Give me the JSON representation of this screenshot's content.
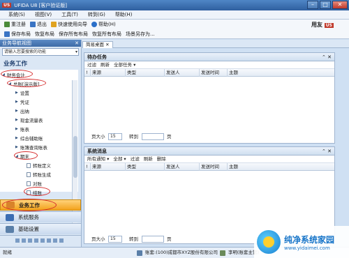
{
  "window": {
    "logo": "US",
    "title": "UFIDA U8 [客户验证版]"
  },
  "menu": [
    "系统(S)",
    "视图(V)",
    "工具(T)",
    "转到(G)",
    "帮助(H)"
  ],
  "toolbar1": [
    {
      "label": "重注册",
      "icon": "refresh-icon"
    },
    {
      "label": "退出",
      "icon": "exit-icon"
    },
    {
      "label": "快速使用向导",
      "icon": "wizard-icon"
    },
    {
      "label": "帮助(H)",
      "icon": "help-icon"
    }
  ],
  "brand": {
    "badge": "US",
    "text": "用友"
  },
  "toolbar2": [
    "保存布局",
    "恢复布局",
    "保存所有布局",
    "恢复所有布局",
    "场景另存为..."
  ],
  "left": {
    "header": "业务导航视图",
    "search_placeholder": "请输入您要搜索的功能",
    "title": "业务工作",
    "tree": [
      {
        "label": "财务会计",
        "level": 0
      },
      {
        "label": "总账[演示版]",
        "level": 1
      },
      {
        "label": "设置",
        "level": 2
      },
      {
        "label": "凭证",
        "level": 2
      },
      {
        "label": "出纳",
        "level": 2
      },
      {
        "label": "现金流量表",
        "level": 2
      },
      {
        "label": "账表",
        "level": 2
      },
      {
        "label": "综合辅助账",
        "level": 2
      },
      {
        "label": "账簿查询账表",
        "level": 2
      },
      {
        "label": "期末",
        "level": 2
      },
      {
        "label": "转账定义",
        "level": 3
      },
      {
        "label": "转账生成",
        "level": 3
      },
      {
        "label": "对账",
        "level": 3
      },
      {
        "label": "结账",
        "level": 3
      }
    ],
    "nav": {
      "active": "业务工作",
      "system": "系统服务",
      "base": "基础设置"
    }
  },
  "tab": "简易桌面",
  "tasks": {
    "title": "待办任务",
    "actions": [
      "过滤",
      "刷新",
      "全部任务 ▾"
    ],
    "columns": [
      "来源",
      "类型",
      "发送人",
      "发送时间",
      "主题"
    ],
    "pager": {
      "size_label": "页大小",
      "size": "15",
      "goto": "转到",
      "page": "页"
    }
  },
  "messages": {
    "title": "系统消息",
    "actions": [
      "所有通知 ▾",
      "全部 ▾",
      "过滤",
      "刷新",
      "删除"
    ],
    "columns": [
      "来源",
      "类型",
      "发送人",
      "发送时间",
      "主题"
    ],
    "pager": {
      "size_label": "页大小",
      "size": "15",
      "goto": "转到",
      "page": "页"
    }
  },
  "status": {
    "left": "就绪",
    "account": "账套:(100)成都市XYZ股份有限公司",
    "user": "李明(账套主管)"
  },
  "watermark": {
    "title": "纯净系统家园",
    "url": "www.yidaimei.com"
  }
}
